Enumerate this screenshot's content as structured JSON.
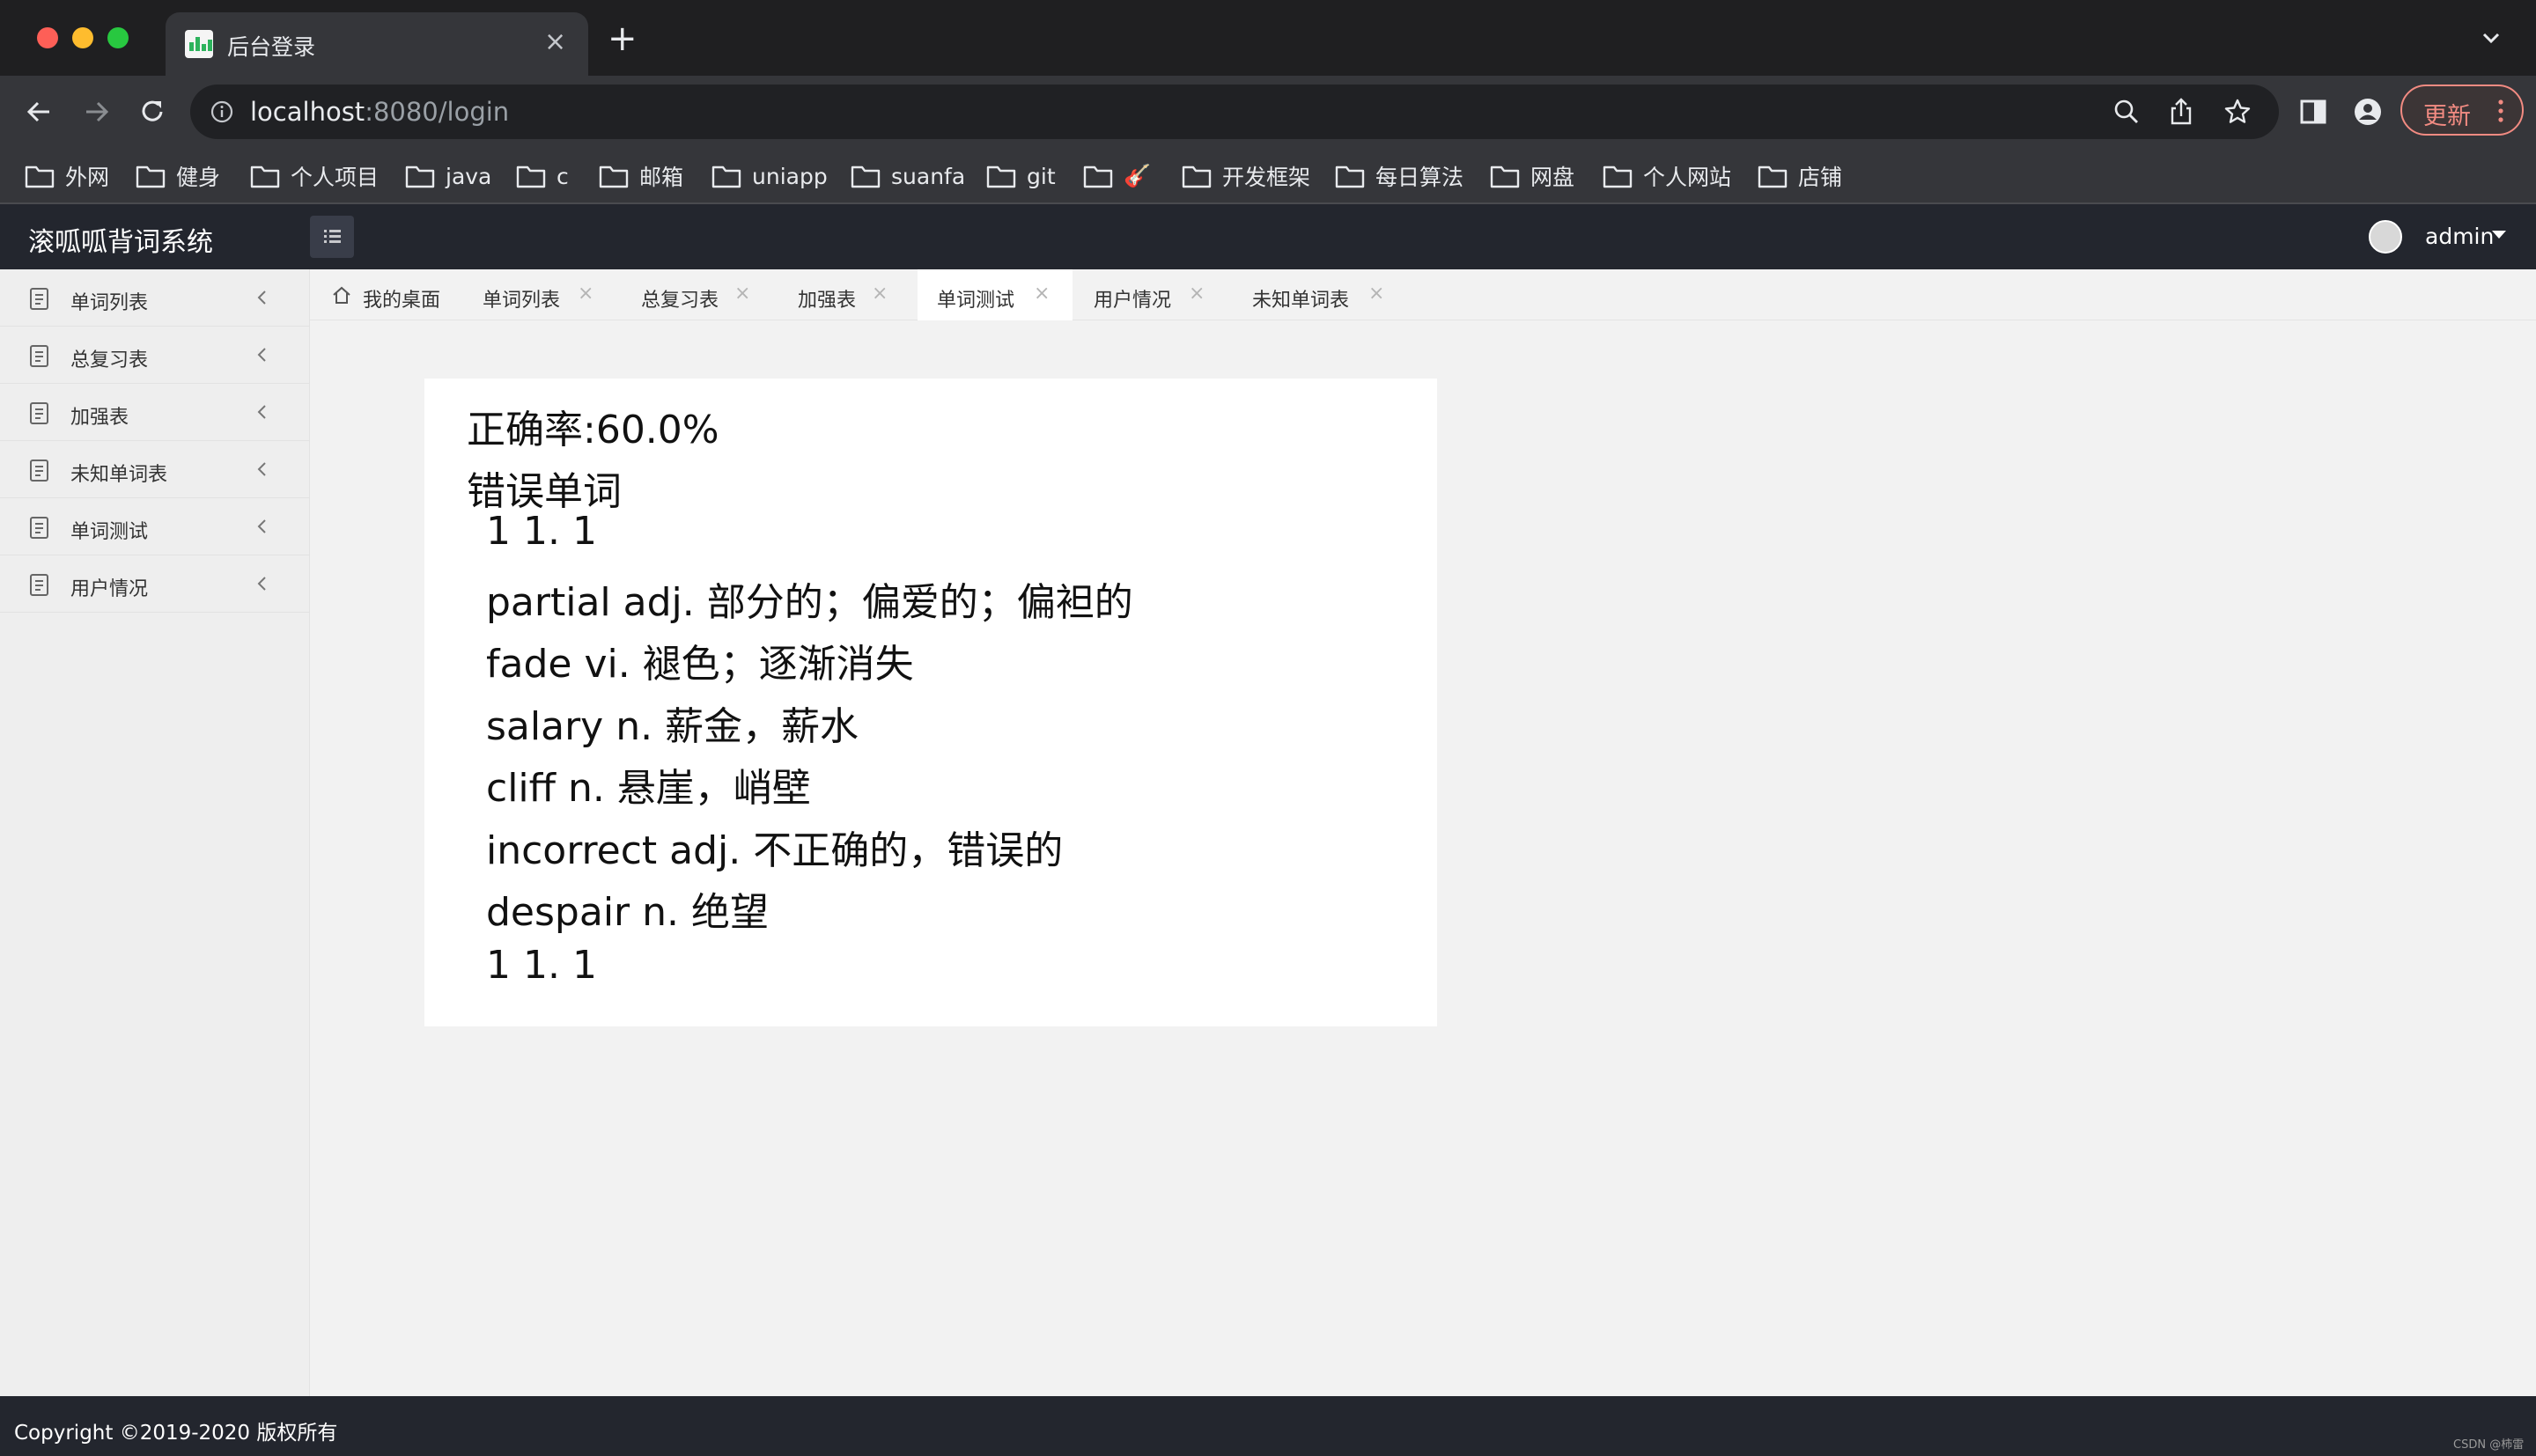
{
  "browser": {
    "tab_title": "后台登录",
    "tab_close": "×",
    "new_tab": "+",
    "url_host": "localhost",
    "url_path": ":8080/login",
    "update_label": "更新",
    "bookmarks": [
      {
        "label": "外网"
      },
      {
        "label": "健身"
      },
      {
        "label": "个人项目"
      },
      {
        "label": "java"
      },
      {
        "label": "c"
      },
      {
        "label": "邮箱"
      },
      {
        "label": "uniapp"
      },
      {
        "label": "suanfa"
      },
      {
        "label": "git"
      },
      {
        "label": "🎸"
      },
      {
        "label": "开发框架"
      },
      {
        "label": "每日算法"
      },
      {
        "label": "网盘"
      },
      {
        "label": "个人网站"
      },
      {
        "label": "店铺"
      }
    ]
  },
  "app": {
    "title": "滚呱呱背词系统",
    "user": "admin",
    "sidebar": [
      {
        "label": "单词列表"
      },
      {
        "label": "总复习表"
      },
      {
        "label": "加强表"
      },
      {
        "label": "未知单词表"
      },
      {
        "label": "单词测试"
      },
      {
        "label": "用户情况"
      }
    ],
    "tabs": [
      {
        "label": "我的桌面",
        "active": false
      },
      {
        "label": "单词列表",
        "active": false
      },
      {
        "label": "总复习表",
        "active": false
      },
      {
        "label": "加强表",
        "active": false
      },
      {
        "label": "单词测试",
        "active": true
      },
      {
        "label": "用户情况",
        "active": false
      },
      {
        "label": "未知单词表",
        "active": false
      }
    ],
    "tab_close": "×",
    "result": {
      "accuracy": "正确率:60.0%",
      "wrong_heading": "错误单词",
      "lines": [
        "1 1. 1",
        "partial adj. 部分的；偏爱的；偏袒的",
        "fade vi. 褪色；逐渐消失",
        "salary n. 薪金，薪水",
        "cliff n. 悬崖，峭壁",
        "incorrect adj. 不正确的，错误的",
        "despair n. 绝望",
        "1 1. 1"
      ]
    },
    "footer": "Copyright ©2019-2020 版权所有",
    "watermark": "CSDN @柿雷"
  },
  "colors": {
    "header_bg": "#23262e",
    "content_bg": "#f2f2f2",
    "sidebar_bg": "#eeeeee",
    "update_accent": "#f28b82"
  }
}
